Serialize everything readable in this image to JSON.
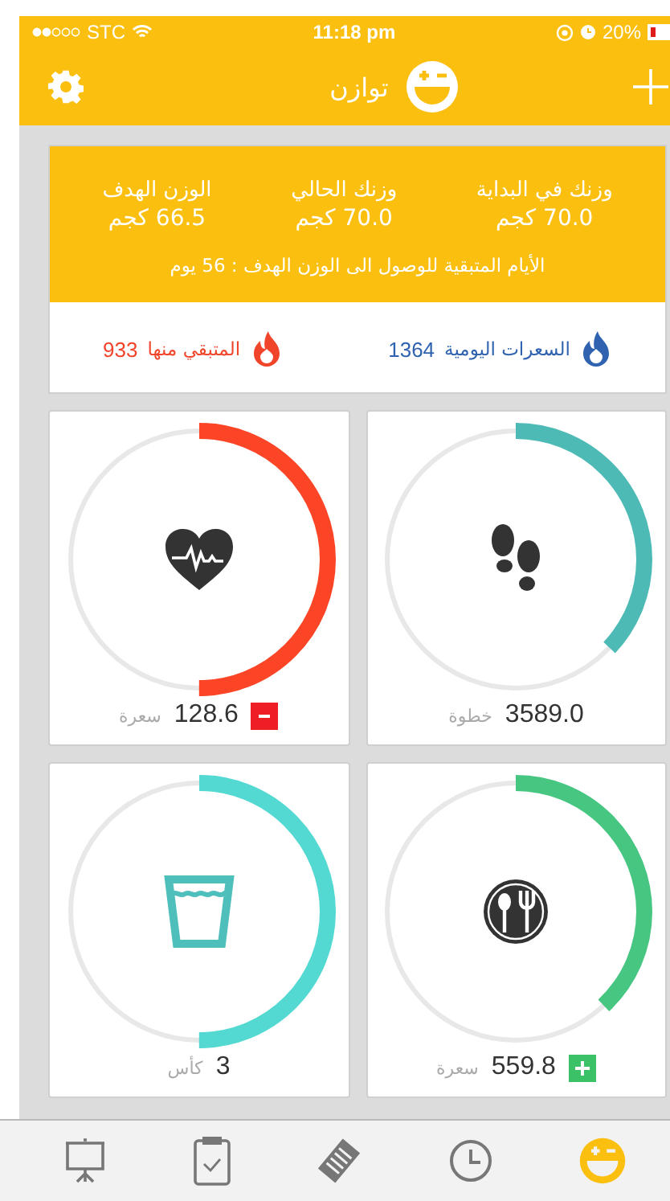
{
  "status_bar": {
    "carrier": "STC",
    "time": "11:18 pm",
    "battery": "20%"
  },
  "nav": {
    "title": "توازن"
  },
  "summary": {
    "stats": [
      {
        "label": "وزنك في البداية",
        "value": "70.0 كجم"
      },
      {
        "label": "وزنك الحالي",
        "value": "70.0 كجم"
      },
      {
        "label": "الوزن الهدف",
        "value": "66.5 كجم"
      }
    ],
    "remaining_days": "الأيام المتبقية للوصول الى الوزن الهدف : 56 يوم",
    "calories": [
      {
        "label": "السعرات اليومية",
        "value": "1364",
        "color": "#2f63b0"
      },
      {
        "label": "المتبقي منها",
        "value": "933",
        "color": "#f0452a"
      }
    ]
  },
  "tiles": [
    {
      "kind": "steps",
      "level": 0.37,
      "color": "#4dbab6",
      "value": "3589.0",
      "unit": "خطوة"
    },
    {
      "kind": "heart",
      "level": 0.5,
      "color": "#fc4526",
      "value": "128.6",
      "unit": "سعرة",
      "badge": {
        "kind": "minus"
      }
    },
    {
      "kind": "food",
      "level": 0.38,
      "color": "#47c682",
      "value": "559.8",
      "unit": "سعرة",
      "badge": {
        "kind": "plus"
      }
    },
    {
      "kind": "water",
      "level": 0.5,
      "color": "#53d9d1",
      "value": "3",
      "unit": "كأس"
    }
  ],
  "tab_bar": [
    {
      "kind": "presentation",
      "selected": false
    },
    {
      "kind": "clipboard",
      "selected": false
    },
    {
      "kind": "notes",
      "selected": false
    },
    {
      "kind": "clock",
      "selected": false
    },
    {
      "kind": "logo",
      "selected": true
    }
  ]
}
